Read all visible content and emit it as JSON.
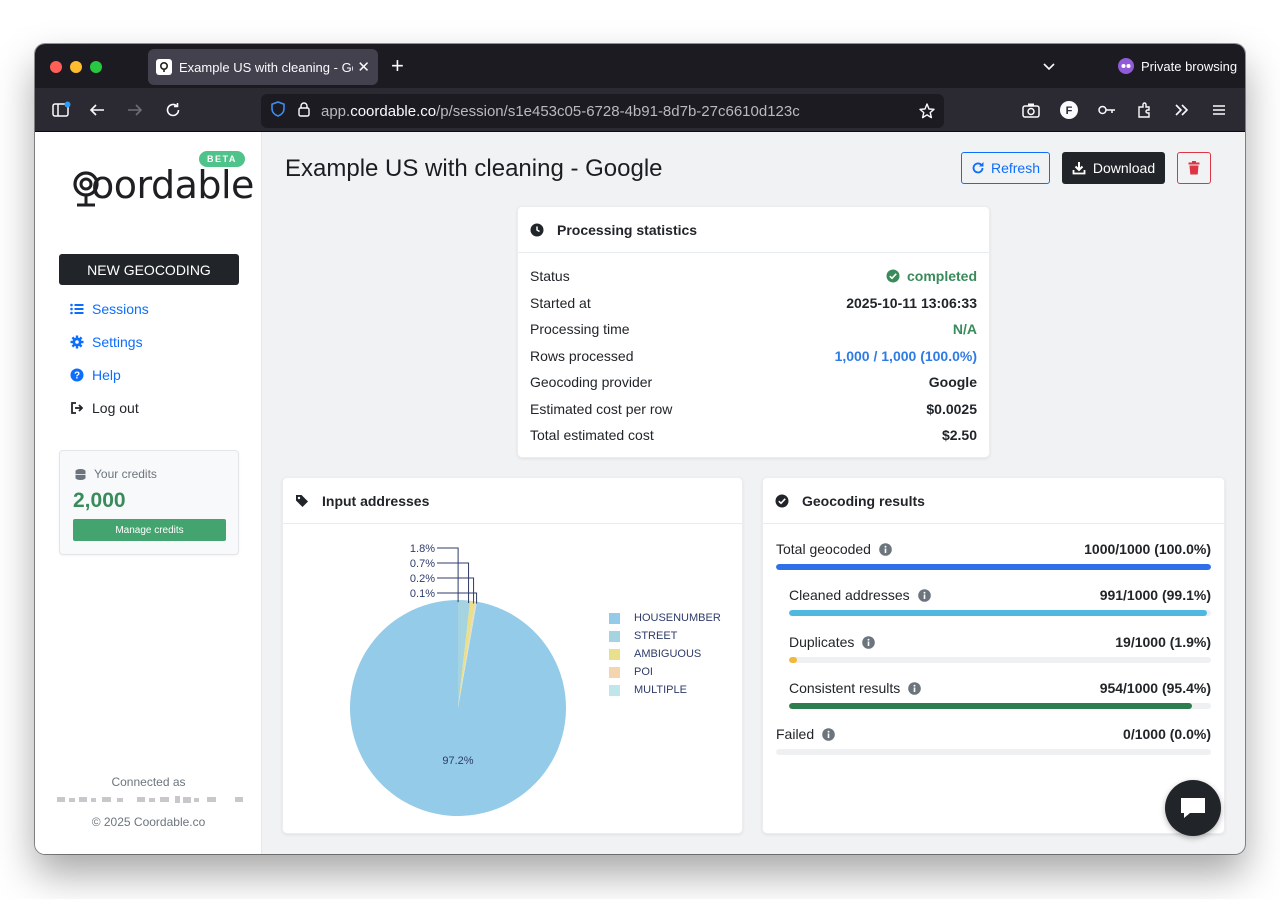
{
  "browser": {
    "tab_title": "Example US with cleaning - Goo",
    "url_prefix": "app.",
    "url_domain": "coordable.co",
    "url_path": "/p/session/s1e453c05-6728-4b91-8d7b-27c6610d123c",
    "private_label": "Private browsing",
    "account_initial": "F"
  },
  "sidebar": {
    "logo": "coordable",
    "beta_badge": "BETA",
    "new_geocoding": "NEW GEOCODING",
    "menu": [
      {
        "label": "Sessions"
      },
      {
        "label": "Settings"
      },
      {
        "label": "Help"
      },
      {
        "label": "Log out"
      }
    ],
    "credits_label": "Your credits",
    "credits_value": "2,000",
    "manage_credits": "Manage credits",
    "connected_as": "Connected as",
    "copyright": "© 2025 Coordable.co"
  },
  "page": {
    "title": "Example US with cleaning - Google",
    "refresh_label": "Refresh",
    "download_label": "Download"
  },
  "stats": {
    "title": "Processing statistics",
    "rows": [
      {
        "label": "Status",
        "value": "completed"
      },
      {
        "label": "Started at",
        "value": "2025-10-11 13:06:33"
      },
      {
        "label": "Processing time",
        "value": "N/A"
      },
      {
        "label": "Rows processed",
        "value": "1,000 / 1,000 (100.0%)"
      },
      {
        "label": "Geocoding provider",
        "value": "Google"
      },
      {
        "label": "Estimated cost per row",
        "value": "$0.0025"
      },
      {
        "label": "Total estimated cost",
        "value": "$2.50"
      }
    ]
  },
  "inputs": {
    "title": "Input addresses"
  },
  "chart_data": {
    "type": "pie",
    "categories": [
      "HOUSENUMBER",
      "STREET",
      "AMBIGUOUS",
      "POI",
      "MULTIPLE"
    ],
    "values": [
      97.2,
      1.8,
      0.7,
      0.2,
      0.1
    ],
    "labels": [
      "97.2%",
      "1.8%",
      "0.7%",
      "0.2%",
      "0.1%"
    ],
    "colors": [
      "#94cbe8",
      "#a5d3e0",
      "#e8e08a",
      "#f5d5b0",
      "#bfe6ea"
    ],
    "legend_position": "right"
  },
  "results": {
    "title": "Geocoding results",
    "rows": [
      {
        "label": "Total geocoded",
        "value": "1000/1000 (100.0%)",
        "fraction": 1.0,
        "color": "#2f6fe8"
      },
      {
        "label": "Cleaned addresses",
        "value": "991/1000 (99.1%)",
        "fraction": 0.991,
        "color": "#4fb8e0"
      },
      {
        "label": "Duplicates",
        "value": "19/1000 (1.9%)",
        "fraction": 0.019,
        "color": "#f0b93a"
      },
      {
        "label": "Consistent results",
        "value": "954/1000 (95.4%)",
        "fraction": 0.954,
        "color": "#2e7d4f"
      },
      {
        "label": "Failed",
        "value": "0/1000 (0.0%)",
        "fraction": 0.0,
        "color": "#dc3545"
      }
    ]
  },
  "icons": {
    "status": "check-circle-icon",
    "stats": "clock-icon",
    "inputs": "tag-icon",
    "results": "check-circle-icon",
    "info": "info-icon",
    "chat": "chat-icon"
  }
}
